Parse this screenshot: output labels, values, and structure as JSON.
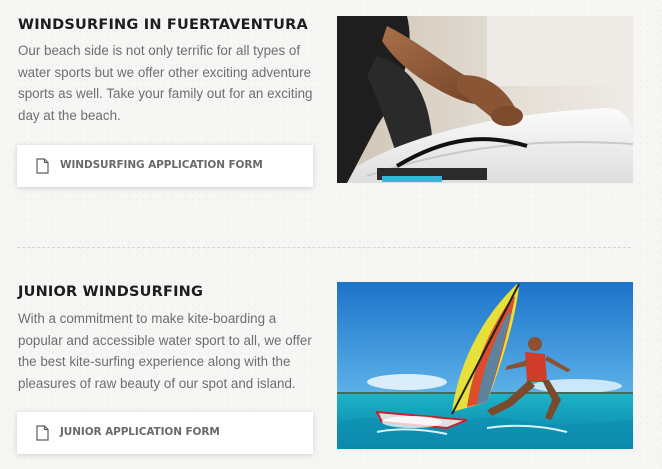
{
  "sections": [
    {
      "title": "WINDSURFING IN FUERTAVENTURA",
      "description": "Our beach side is not only terrific for all types of water sports but we offer other exciting adventure sports as well. Take your family out for an exciting day at the beach.",
      "button_label": "WINDSURFING APPLICATION FORM",
      "button_icon": "document-icon",
      "image": "hands-waxing-surfboard-photo"
    },
    {
      "title": "JUNIOR WINDSURFING",
      "description": "With a commitment to make kite-boarding a popular and accessible water sport to all, we offer the best kite-surfing experience along with the pleasures of raw beauty of our spot and island.",
      "button_label": "JUNIOR APPLICATION FORM",
      "button_icon": "document-icon",
      "image": "windsurfer-on-sea-photo"
    }
  ],
  "colors": {
    "background": "#f6f6f4",
    "title": "#1d1d1d",
    "text": "#6e6e6e",
    "button_text": "#6a6a6a",
    "sail_yellow": "#e8e03a",
    "sail_red": "#d8332a",
    "sea": "#1aa7c4"
  }
}
